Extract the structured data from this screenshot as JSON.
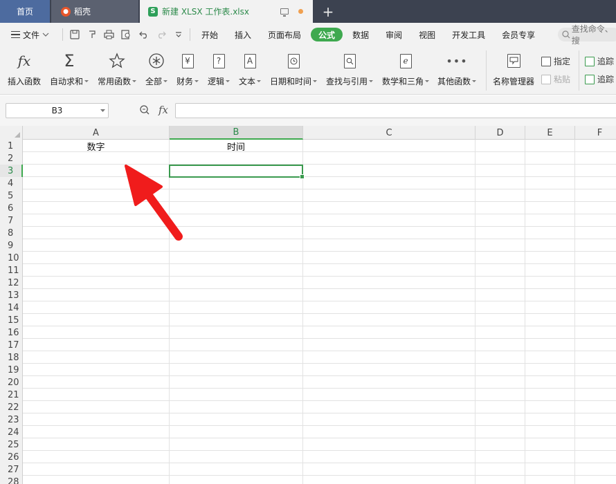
{
  "tabs": {
    "home": "首页",
    "daoke": "稻壳",
    "file": "新建 XLSX 工作表.xlsx"
  },
  "menu": {
    "file_label": "文件",
    "items": [
      "开始",
      "插入",
      "页面布局",
      "公式",
      "数据",
      "审阅",
      "视图",
      "开发工具",
      "会员专享"
    ],
    "active": "公式",
    "search_placeholder": "查找命令、搜"
  },
  "ribbon": {
    "buttons": [
      {
        "label": "插入函数",
        "icon": "fx-icon"
      },
      {
        "label": "自动求和",
        "icon": "sigma-icon"
      },
      {
        "label": "常用函数",
        "icon": "star-icon"
      },
      {
        "label": "全部",
        "icon": "asterisk-icon"
      },
      {
        "label": "财务",
        "icon": "yen-icon"
      },
      {
        "label": "逻辑",
        "icon": "question-icon"
      },
      {
        "label": "文本",
        "icon": "text-a-icon"
      },
      {
        "label": "日期和时间",
        "icon": "clock-icon"
      },
      {
        "label": "查找与引用",
        "icon": "lookup-icon"
      },
      {
        "label": "数学和三角",
        "icon": "math-e-icon"
      },
      {
        "label": "其他函数",
        "icon": "more-dots-icon"
      },
      {
        "label": "名称管理器",
        "icon": "name-manager-icon"
      }
    ],
    "assign_label": "指定",
    "paste_label": "粘贴",
    "trace1_label": "追踪",
    "trace2_label": "追踪"
  },
  "formula_bar": {
    "name_box": "B3",
    "fx": "fx",
    "content": ""
  },
  "sheet": {
    "columns": [
      "A",
      "B",
      "C",
      "D",
      "E",
      "F"
    ],
    "selected_column": "B",
    "rows": [
      "1",
      "2",
      "3",
      "4",
      "5",
      "6",
      "7",
      "8",
      "9",
      "10",
      "11",
      "12",
      "13",
      "14",
      "15",
      "16",
      "17",
      "18",
      "19",
      "20",
      "21",
      "22",
      "23",
      "24",
      "25",
      "26",
      "27",
      "28"
    ],
    "selected_row": "3",
    "cells": {
      "A1": "数字",
      "B1": "时间"
    },
    "selected_cell": "B3"
  },
  "colors": {
    "accent_green": "#3ea94f",
    "annotation_arrow": "#f01c1c",
    "tabbar_bg": "#3c4250"
  }
}
